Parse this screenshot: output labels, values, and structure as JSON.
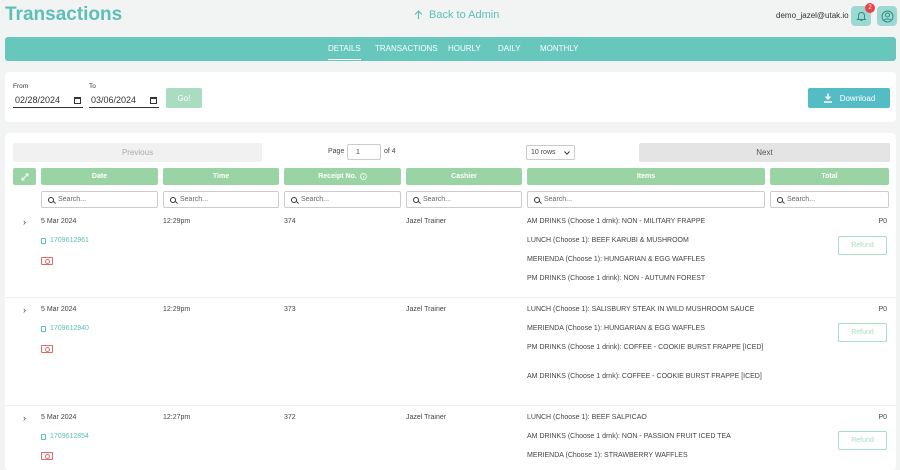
{
  "header": {
    "title": "Transactions",
    "back_label": "Back to Admin",
    "user_email": "demo_jazel@utak.io",
    "notification_count": "2"
  },
  "nav": {
    "tabs": [
      {
        "label": "DETAILS",
        "active": true
      },
      {
        "label": "TRANSACTIONS",
        "active": false
      },
      {
        "label": "HOURLY",
        "active": false
      },
      {
        "label": "DAILY",
        "active": false
      },
      {
        "label": "MONTHLY",
        "active": false
      }
    ]
  },
  "filters": {
    "from_label": "From",
    "from_value": "02/28/2024",
    "to_label": "To",
    "to_value": "03/06/2024",
    "go_label": "Go!",
    "download_label": "Download"
  },
  "pagination": {
    "prev_label": "Previous",
    "next_label": "Next",
    "page_label": "Page",
    "page_value": "1",
    "page_total": "of 4",
    "rows_value": "10 rows"
  },
  "columns": [
    "Date",
    "Time",
    "Receipt No.",
    "Cashier",
    "Items",
    "Total"
  ],
  "search_placeholder": "Search...",
  "refund_label": "Refund",
  "rows": [
    {
      "date": "5 Mar 2024",
      "time": "12:29pm",
      "receipt": "374",
      "cashier": "Jazel Trainer",
      "order_id": "1709612961",
      "total": "P0",
      "items": [
        "AM DRINKS (Choose 1 drnk): NON - MILITARY FRAPPE",
        "LUNCH (Choose 1): BEEF KARUBI & MUSHROOM",
        "MERIENDA (Choose 1): HUNGARIAN & EGG WAFFLES",
        "PM DRINKS (Choose 1 drink): NON - AUTUMN FOREST"
      ]
    },
    {
      "date": "5 Mar 2024",
      "time": "12:29pm",
      "receipt": "373",
      "cashier": "Jazel Trainer",
      "order_id": "1709612940",
      "total": "P0",
      "items": [
        "LUNCH (Choose 1): SALISBURY STEAK IN WILD MUSHROOM SAUCE",
        "MERIENDA (Choose 1): HUNGARIAN & EGG WAFFLES",
        "PM DRINKS (Choose 1 drink): COFFEE - COOKIE BURST FRAPPE [ICED]",
        "AM DRINKS (Choose 1 drnk): COFFEE - COOKIE BURST FRAPPE [ICED]"
      ]
    },
    {
      "date": "5 Mar 2024",
      "time": "12:27pm",
      "receipt": "372",
      "cashier": "Jazel Trainer",
      "order_id": "1709612854",
      "total": "P0",
      "items": [
        "LUNCH (Choose 1): BEEF SALPICAO",
        "AM DRINKS (Choose 1 drnk): NON - PASSION FRUIT ICED TEA",
        "MERIENDA (Choose 1): STRAWBERRY WAFFLES"
      ]
    }
  ],
  "colors": {
    "accent": "#5cc0b6",
    "nav_bg": "#67c7bd",
    "header_green": "#9ad4a4",
    "download": "#54bcc5",
    "refund": "#a9dcc1"
  }
}
